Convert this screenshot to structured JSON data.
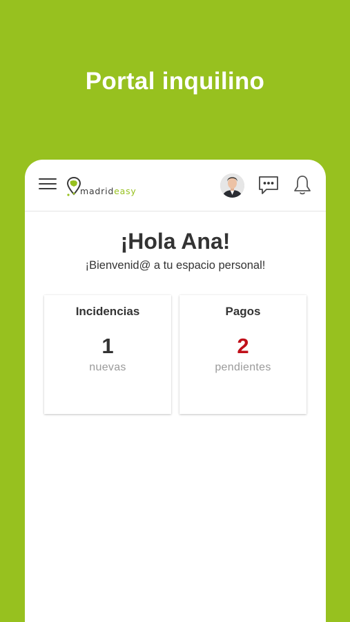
{
  "promo": {
    "title": "Portal inquilino"
  },
  "header": {
    "logo_text_part1": "madrid",
    "logo_text_part2": "easy"
  },
  "main": {
    "greeting": "¡Hola Ana!",
    "welcome": "¡Bienvenid@ a tu espacio personal!"
  },
  "cards": [
    {
      "title": "Incidencias",
      "count": "1",
      "subtitle": "nuevas"
    },
    {
      "title": "Pagos",
      "count": "2",
      "subtitle": "pendientes"
    }
  ],
  "colors": {
    "brand_green": "#97c11f",
    "alert_red": "#c0101a",
    "text_dark": "#333333",
    "text_muted": "#9a9a9a"
  },
  "icons": [
    "menu-icon",
    "logo-pin-icon",
    "avatar",
    "chat-icon",
    "bell-icon"
  ]
}
